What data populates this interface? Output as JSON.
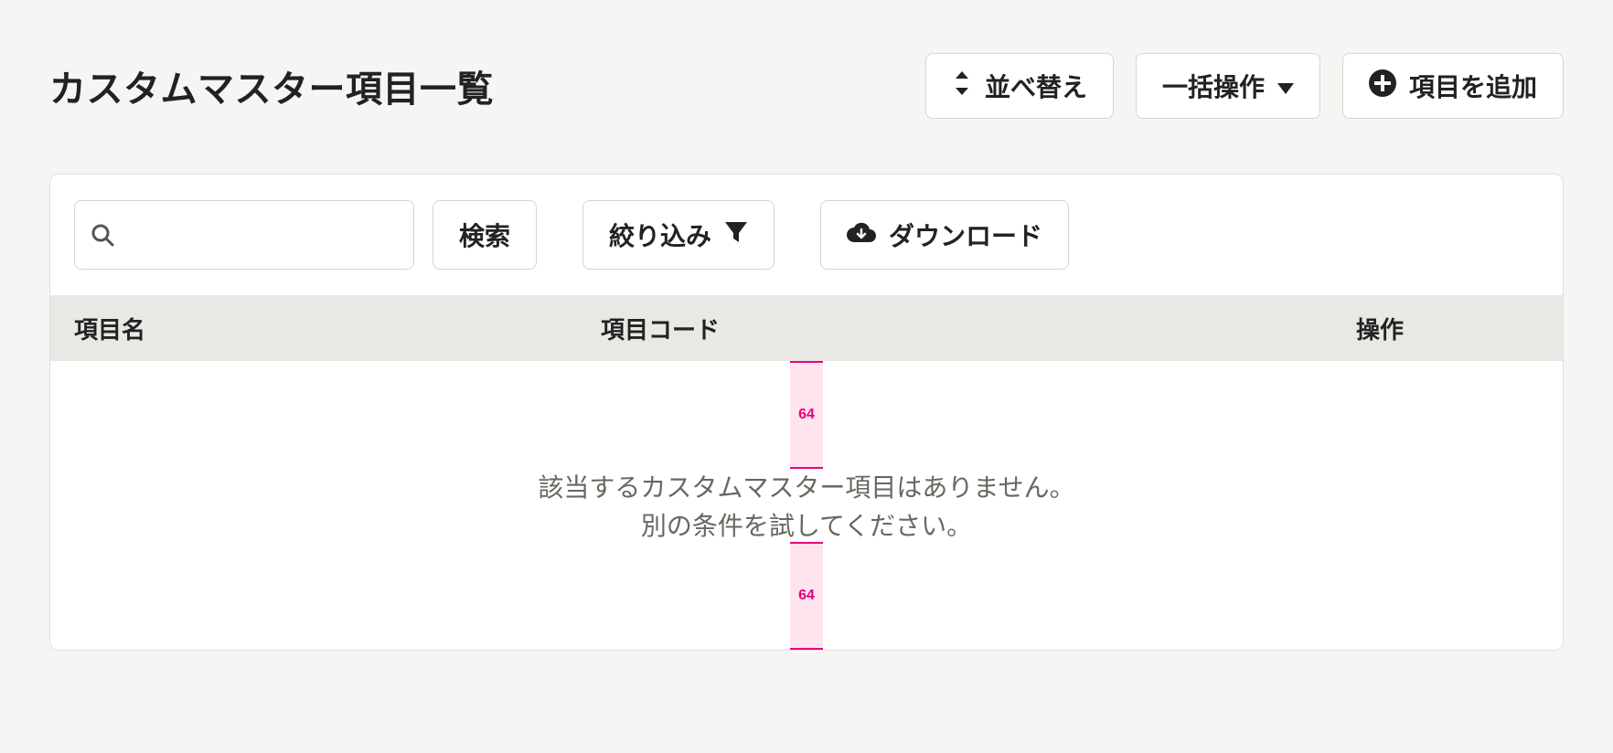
{
  "header": {
    "title": "カスタムマスター項目一覧",
    "sort_label": "並べ替え",
    "bulk_label": "一括操作",
    "add_label": "項目を追加"
  },
  "toolbar": {
    "search_value": "",
    "search_placeholder": "",
    "search_button_label": "検索",
    "filter_label": "絞り込み",
    "download_label": "ダウンロード"
  },
  "table": {
    "col_name": "項目名",
    "col_code": "項目コード",
    "col_action": "操作",
    "rows": []
  },
  "empty": {
    "line1": "該当するカスタムマスター項目はありません。",
    "line2": "別の条件を試してください。"
  },
  "overlay": {
    "spacing_top": "64",
    "spacing_bottom": "64"
  }
}
